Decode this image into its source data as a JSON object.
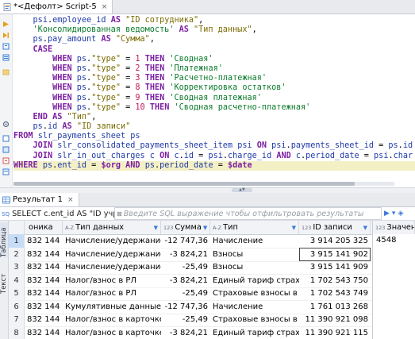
{
  "editor": {
    "tab_label": "*<Дефолт> Script-5",
    "close_glyph": "×"
  },
  "sql_lines": [
    [
      {
        "t": "    "
      },
      {
        "t": "psi",
        "c": "id"
      },
      {
        "t": "."
      },
      {
        "t": "employee_id",
        "c": "id"
      },
      {
        "t": " "
      },
      {
        "t": "AS",
        "c": "kw"
      },
      {
        "t": " "
      },
      {
        "t": "\"ID сотрудника\"",
        "c": "dq"
      },
      {
        "t": ","
      }
    ],
    [
      {
        "t": "    "
      },
      {
        "t": "'Консолидированная ведомость'",
        "c": "str"
      },
      {
        "t": " "
      },
      {
        "t": "AS",
        "c": "kw"
      },
      {
        "t": " "
      },
      {
        "t": "\"Тип данных\"",
        "c": "dq"
      },
      {
        "t": ","
      }
    ],
    [
      {
        "t": "    "
      },
      {
        "t": "ps",
        "c": "id"
      },
      {
        "t": "."
      },
      {
        "t": "pay_amount",
        "c": "id"
      },
      {
        "t": " "
      },
      {
        "t": "AS",
        "c": "kw"
      },
      {
        "t": " "
      },
      {
        "t": "\"Сумма\"",
        "c": "dq"
      },
      {
        "t": ","
      }
    ],
    [
      {
        "t": "    "
      },
      {
        "t": "CASE",
        "c": "kw"
      }
    ],
    [
      {
        "t": "        "
      },
      {
        "t": "WHEN",
        "c": "kw"
      },
      {
        "t": " "
      },
      {
        "t": "ps",
        "c": "id"
      },
      {
        "t": "."
      },
      {
        "t": "\"type\"",
        "c": "dq"
      },
      {
        "t": " = "
      },
      {
        "t": "1",
        "c": "num"
      },
      {
        "t": " "
      },
      {
        "t": "THEN",
        "c": "kw"
      },
      {
        "t": " "
      },
      {
        "t": "'Сводная'",
        "c": "str"
      }
    ],
    [
      {
        "t": "        "
      },
      {
        "t": "WHEN",
        "c": "kw"
      },
      {
        "t": " "
      },
      {
        "t": "ps",
        "c": "id"
      },
      {
        "t": "."
      },
      {
        "t": "\"type\"",
        "c": "dq"
      },
      {
        "t": " = "
      },
      {
        "t": "2",
        "c": "num"
      },
      {
        "t": " "
      },
      {
        "t": "THEN",
        "c": "kw"
      },
      {
        "t": " "
      },
      {
        "t": "'Платежная'",
        "c": "str"
      }
    ],
    [
      {
        "t": "        "
      },
      {
        "t": "WHEN",
        "c": "kw"
      },
      {
        "t": " "
      },
      {
        "t": "ps",
        "c": "id"
      },
      {
        "t": "."
      },
      {
        "t": "\"type\"",
        "c": "dq"
      },
      {
        "t": " = "
      },
      {
        "t": "3",
        "c": "num"
      },
      {
        "t": " "
      },
      {
        "t": "THEN",
        "c": "kw"
      },
      {
        "t": " "
      },
      {
        "t": "'Расчетно-платежная'",
        "c": "str"
      }
    ],
    [
      {
        "t": "        "
      },
      {
        "t": "WHEN",
        "c": "kw"
      },
      {
        "t": " "
      },
      {
        "t": "ps",
        "c": "id"
      },
      {
        "t": "."
      },
      {
        "t": "\"type\"",
        "c": "dq"
      },
      {
        "t": " = "
      },
      {
        "t": "8",
        "c": "num"
      },
      {
        "t": " "
      },
      {
        "t": "THEN",
        "c": "kw"
      },
      {
        "t": " "
      },
      {
        "t": "'Корректировка остатков'",
        "c": "str"
      }
    ],
    [
      {
        "t": "        "
      },
      {
        "t": "WHEN",
        "c": "kw"
      },
      {
        "t": " "
      },
      {
        "t": "ps",
        "c": "id"
      },
      {
        "t": "."
      },
      {
        "t": "\"type\"",
        "c": "dq"
      },
      {
        "t": " = "
      },
      {
        "t": "9",
        "c": "num"
      },
      {
        "t": " "
      },
      {
        "t": "THEN",
        "c": "kw"
      },
      {
        "t": " "
      },
      {
        "t": "'Сводная платежная'",
        "c": "str"
      }
    ],
    [
      {
        "t": "        "
      },
      {
        "t": "WHEN",
        "c": "kw"
      },
      {
        "t": " "
      },
      {
        "t": "ps",
        "c": "id"
      },
      {
        "t": "."
      },
      {
        "t": "\"type\"",
        "c": "dq"
      },
      {
        "t": " = "
      },
      {
        "t": "10",
        "c": "num"
      },
      {
        "t": " "
      },
      {
        "t": "THEN",
        "c": "kw"
      },
      {
        "t": " "
      },
      {
        "t": "'Сводная расчетно-платежная'",
        "c": "str"
      }
    ],
    [
      {
        "t": "    "
      },
      {
        "t": "END",
        "c": "kw"
      },
      {
        "t": " "
      },
      {
        "t": "AS",
        "c": "kw"
      },
      {
        "t": " "
      },
      {
        "t": "\"Тип\"",
        "c": "dq"
      },
      {
        "t": ","
      }
    ],
    [
      {
        "t": "    "
      },
      {
        "t": "ps",
        "c": "id"
      },
      {
        "t": "."
      },
      {
        "t": "id",
        "c": "id"
      },
      {
        "t": " "
      },
      {
        "t": "AS",
        "c": "kw"
      },
      {
        "t": " "
      },
      {
        "t": "\"ID записи\"",
        "c": "dq"
      }
    ],
    [
      {
        "t": "FROM",
        "c": "kw"
      },
      {
        "t": " "
      },
      {
        "t": "slr_payments_sheet",
        "c": "id"
      },
      {
        "t": " "
      },
      {
        "t": "ps",
        "c": "id"
      }
    ],
    [
      {
        "t": "    "
      },
      {
        "t": "JOIN",
        "c": "kw"
      },
      {
        "t": " "
      },
      {
        "t": "slr_consolidated_payments_sheet_item",
        "c": "id"
      },
      {
        "t": " "
      },
      {
        "t": "psi",
        "c": "id"
      },
      {
        "t": " "
      },
      {
        "t": "ON",
        "c": "kw"
      },
      {
        "t": " "
      },
      {
        "t": "psi",
        "c": "id"
      },
      {
        "t": "."
      },
      {
        "t": "payments_sheet_id",
        "c": "id"
      },
      {
        "t": " = "
      },
      {
        "t": "ps",
        "c": "id"
      },
      {
        "t": "."
      },
      {
        "t": "id",
        "c": "id"
      }
    ],
    [
      {
        "t": "    "
      },
      {
        "t": "JOIN",
        "c": "kw"
      },
      {
        "t": " "
      },
      {
        "t": "slr_in_out_charges",
        "c": "id"
      },
      {
        "t": " "
      },
      {
        "t": "c",
        "c": "id"
      },
      {
        "t": " "
      },
      {
        "t": "ON",
        "c": "kw"
      },
      {
        "t": " "
      },
      {
        "t": "c",
        "c": "id"
      },
      {
        "t": "."
      },
      {
        "t": "id",
        "c": "id"
      },
      {
        "t": " = "
      },
      {
        "t": "psi",
        "c": "id"
      },
      {
        "t": "."
      },
      {
        "t": "charge_id",
        "c": "id"
      },
      {
        "t": " "
      },
      {
        "t": "AND",
        "c": "kw"
      },
      {
        "t": " "
      },
      {
        "t": "c",
        "c": "id"
      },
      {
        "t": "."
      },
      {
        "t": "period_date",
        "c": "id"
      },
      {
        "t": " = "
      },
      {
        "t": "psi",
        "c": "id"
      },
      {
        "t": "."
      },
      {
        "t": "char",
        "c": "id"
      }
    ],
    [
      {
        "t": "WHERE",
        "c": "kw"
      },
      {
        "t": " "
      },
      {
        "t": "ps",
        "c": "id"
      },
      {
        "t": "."
      },
      {
        "t": "ent_id",
        "c": "id"
      },
      {
        "t": " = "
      },
      {
        "t": "$org",
        "c": "var"
      },
      {
        "t": " "
      },
      {
        "t": "AND",
        "c": "kw"
      },
      {
        "t": " "
      },
      {
        "t": "ps",
        "c": "id"
      },
      {
        "t": "."
      },
      {
        "t": "period_date",
        "c": "id"
      },
      {
        "t": " = "
      },
      {
        "t": "$date",
        "c": "var"
      }
    ]
  ],
  "results": {
    "tab_label": "Результат 1",
    "close_glyph": "×",
    "query_text": "SELECT c.ent_id AS \"ID учрежде",
    "filter_placeholder": "Введите SQL выражение чтобы отфильтровать результаты",
    "side_tabs": [
      "Таблица",
      "Текст"
    ],
    "columns": [
      {
        "label": "оника",
        "badge": ""
      },
      {
        "label": "Тип данных",
        "badge": "A-Z"
      },
      {
        "label": "Сумма",
        "badge": "123"
      },
      {
        "label": "Тип",
        "badge": "A-Z"
      },
      {
        "label": "ID записи",
        "badge": "123"
      },
      {
        "label": "Значени",
        "badge": "123"
      }
    ],
    "value_preview": "4548",
    "rows": [
      {
        "n": "1",
        "emp": "832 144",
        "type": "Начисление/удержание",
        "sum": "-12 747,36",
        "kind": "Начисление",
        "id": "3 914 205 325"
      },
      {
        "n": "2",
        "emp": "832 144",
        "type": "Начисление/удержание",
        "sum": "-3 824,21",
        "kind": "Взносы",
        "id": "3 915 141 902"
      },
      {
        "n": "3",
        "emp": "832 144",
        "type": "Начисление/удержание",
        "sum": "-25,49",
        "kind": "Взносы",
        "id": "3 915 141 909"
      },
      {
        "n": "4",
        "emp": "832 144",
        "type": "Налог/взнос в РЛ",
        "sum": "-3 824,21",
        "kind": "Единый тариф страховых взнс",
        "id": "1 702 543 750"
      },
      {
        "n": "5",
        "emp": "832 144",
        "type": "Налог/взнос в РЛ",
        "sum": "-25,49",
        "kind": "Страховые взносы в Фонд Со",
        "id": "1 702 543 749"
      },
      {
        "n": "6",
        "emp": "832 144",
        "type": "Кумулятивные данные",
        "sum": "-12 747,36",
        "kind": "Начисление",
        "id": "1 761 013 268"
      },
      {
        "n": "7",
        "emp": "832 144",
        "type": "Налог/взнос в карточке",
        "sum": "-25,49",
        "kind": "Страховые взносы в Фонд Со",
        "id": "11 390 921 098"
      },
      {
        "n": "8",
        "emp": "832 144",
        "type": "Налог/взнос в карточке",
        "sum": "-3 824,21",
        "kind": "Единый тариф страховых взнс",
        "id": "11 390 921 115"
      }
    ]
  },
  "colors": {
    "keyword": "#7b1fa2",
    "string": "#0b7a2b",
    "identifier": "#1f3aa8",
    "number": "#c2185b"
  }
}
